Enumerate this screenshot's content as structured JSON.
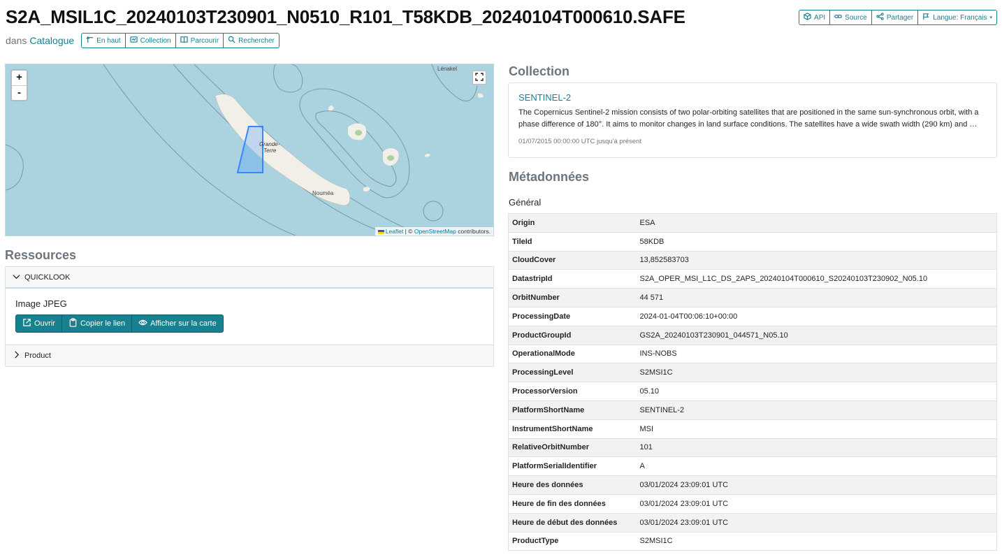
{
  "header": {
    "title": "S2A_MSIL1C_20240103T230901_N0510_R101_T58KDB_20240104T000610.SAFE",
    "in_label": "dans",
    "catalog_link": "Catalogue",
    "nav_buttons": [
      {
        "label": "En haut",
        "icon": "arrow-up-icon"
      },
      {
        "label": "Collection",
        "icon": "collection-icon"
      },
      {
        "label": "Parcourir",
        "icon": "book-icon"
      },
      {
        "label": "Rechercher",
        "icon": "search-icon"
      }
    ],
    "action_buttons": [
      {
        "label": "API",
        "icon": "cube-icon"
      },
      {
        "label": "Source",
        "icon": "link-icon"
      },
      {
        "label": "Partager",
        "icon": "share-icon"
      },
      {
        "label": "Langue: Français",
        "icon": "flag-icon"
      }
    ]
  },
  "map": {
    "zoom_in": "+",
    "zoom_out": "-",
    "labels": {
      "lenakel": "Lénakel",
      "grande": "Grande-",
      "terre": "Terre",
      "noumea": "Nouméa"
    },
    "attribution": {
      "leaflet": "Leaflet",
      "sep": "| ©",
      "osm": "OpenStreetMap",
      "contrib": "contributors."
    },
    "colors": {
      "water": "#aad3df",
      "land": "#f2efe9",
      "footprint": "#3388ff"
    }
  },
  "resources": {
    "heading": "Ressources",
    "quicklook": {
      "label": "QUICKLOOK",
      "title": "Image JPEG",
      "buttons": [
        {
          "label": "Ouvrir",
          "icon": "external-link-icon"
        },
        {
          "label": "Copier le lien",
          "icon": "clipboard-icon"
        },
        {
          "label": "Afficher sur la carte",
          "icon": "eye-icon"
        }
      ]
    },
    "product": {
      "label": "Product"
    }
  },
  "collection": {
    "heading": "Collection",
    "name": "SENTINEL-2",
    "description": "The Copernicus Sentinel-2 mission consists of two polar-orbiting satellites that are positioned in the same sun-synchronous orbit, with a phase difference of 180°. It aims to monitor changes in land surface conditions. The satellites have a wide swath width (290 km) and …",
    "date_range": "01/07/2015 00:00:00 UTC jusqu'à présent"
  },
  "metadata": {
    "heading": "Métadonnées",
    "general": "Général",
    "rows": [
      {
        "key": "Origin",
        "value": "ESA"
      },
      {
        "key": "TileId",
        "value": "58KDB"
      },
      {
        "key": "CloudCover",
        "value": "13,852583703"
      },
      {
        "key": "DatastripId",
        "value": "S2A_OPER_MSI_L1C_DS_2APS_20240104T000610_S20240103T230902_N05.10"
      },
      {
        "key": "OrbitNumber",
        "value": "44 571"
      },
      {
        "key": "ProcessingDate",
        "value": "2024-01-04T00:06:10+00:00"
      },
      {
        "key": "ProductGroupId",
        "value": "GS2A_20240103T230901_044571_N05.10"
      },
      {
        "key": "OperationalMode",
        "value": "INS-NOBS"
      },
      {
        "key": "ProcessingLevel",
        "value": "S2MSI1C"
      },
      {
        "key": "ProcessorVersion",
        "value": "05.10"
      },
      {
        "key": "PlatformShortName",
        "value": "SENTINEL-2"
      },
      {
        "key": "InstrumentShortName",
        "value": "MSI"
      },
      {
        "key": "RelativeOrbitNumber",
        "value": "101"
      },
      {
        "key": "PlatformSerialIdentifier",
        "value": "A"
      },
      {
        "key": "Heure des données",
        "value": "03/01/2024 23:09:01 UTC"
      },
      {
        "key": "Heure de fin des données",
        "value": "03/01/2024 23:09:01 UTC"
      },
      {
        "key": "Heure de début des données",
        "value": "03/01/2024 23:09:01 UTC"
      },
      {
        "key": "ProductType",
        "value": "S2MSI1C"
      }
    ]
  }
}
